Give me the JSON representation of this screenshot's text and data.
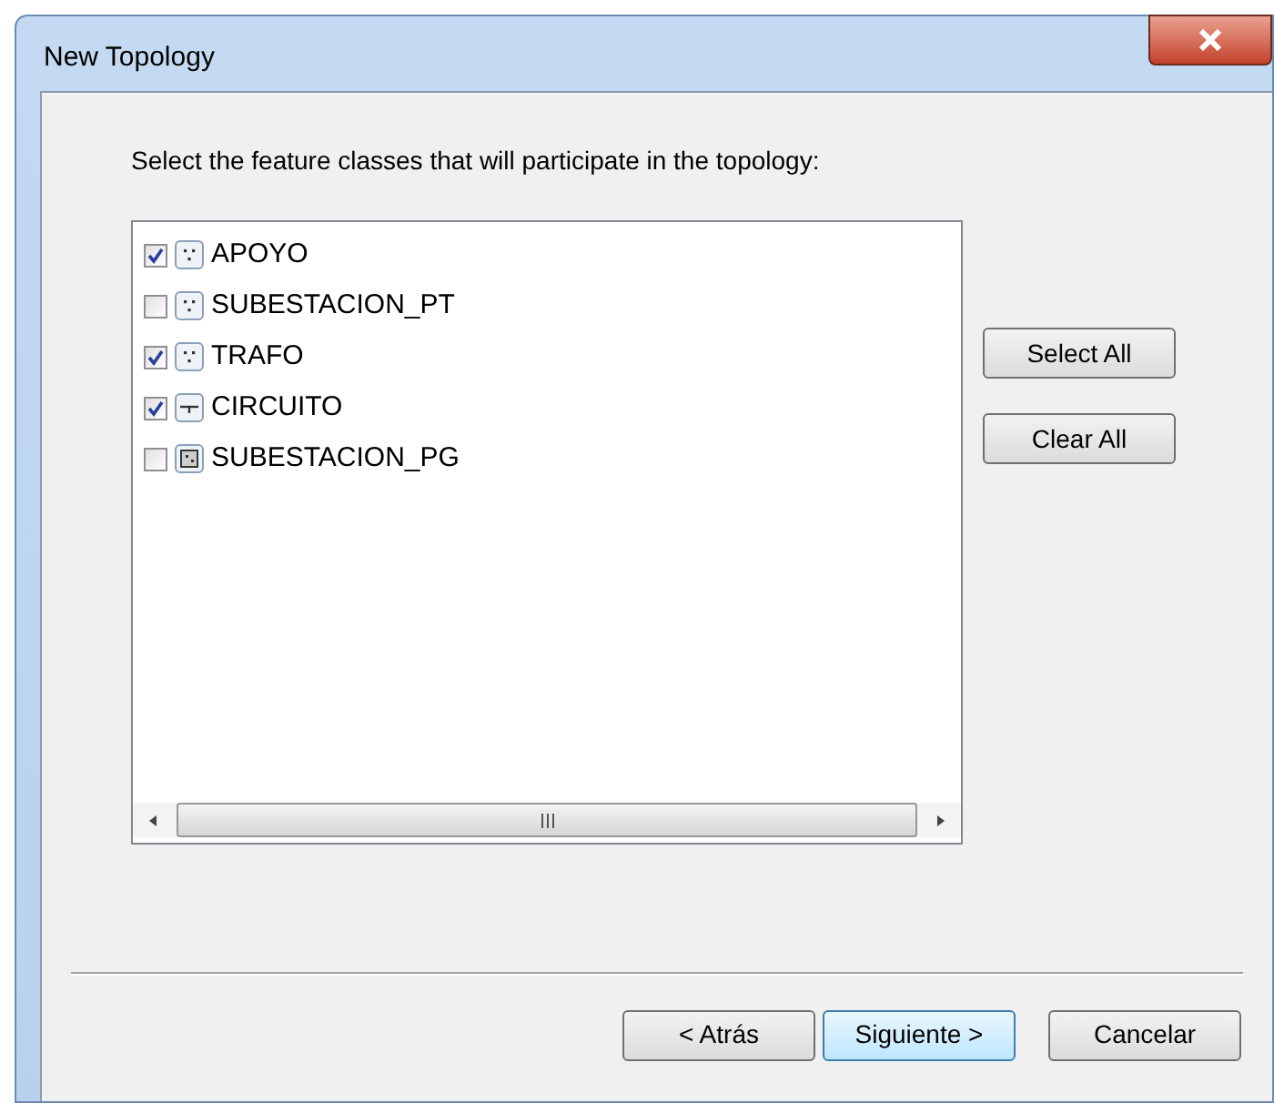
{
  "window": {
    "title": "New Topology"
  },
  "instruction": "Select the feature classes that will participate in the topology:",
  "feature_classes": [
    {
      "name": "APOYO",
      "checked": true,
      "kind": "point"
    },
    {
      "name": "SUBESTACION_PT",
      "checked": false,
      "kind": "point"
    },
    {
      "name": "TRAFO",
      "checked": true,
      "kind": "point"
    },
    {
      "name": "CIRCUITO",
      "checked": true,
      "kind": "line"
    },
    {
      "name": "SUBESTACION_PG",
      "checked": false,
      "kind": "polygon"
    }
  ],
  "side_buttons": [
    "Select All",
    "Clear All"
  ],
  "footer_buttons": [
    {
      "label": "< Atrás",
      "default": false
    },
    {
      "label": "Siguiente >",
      "default": true
    },
    {
      "label": "Cancelar",
      "default": false
    }
  ]
}
